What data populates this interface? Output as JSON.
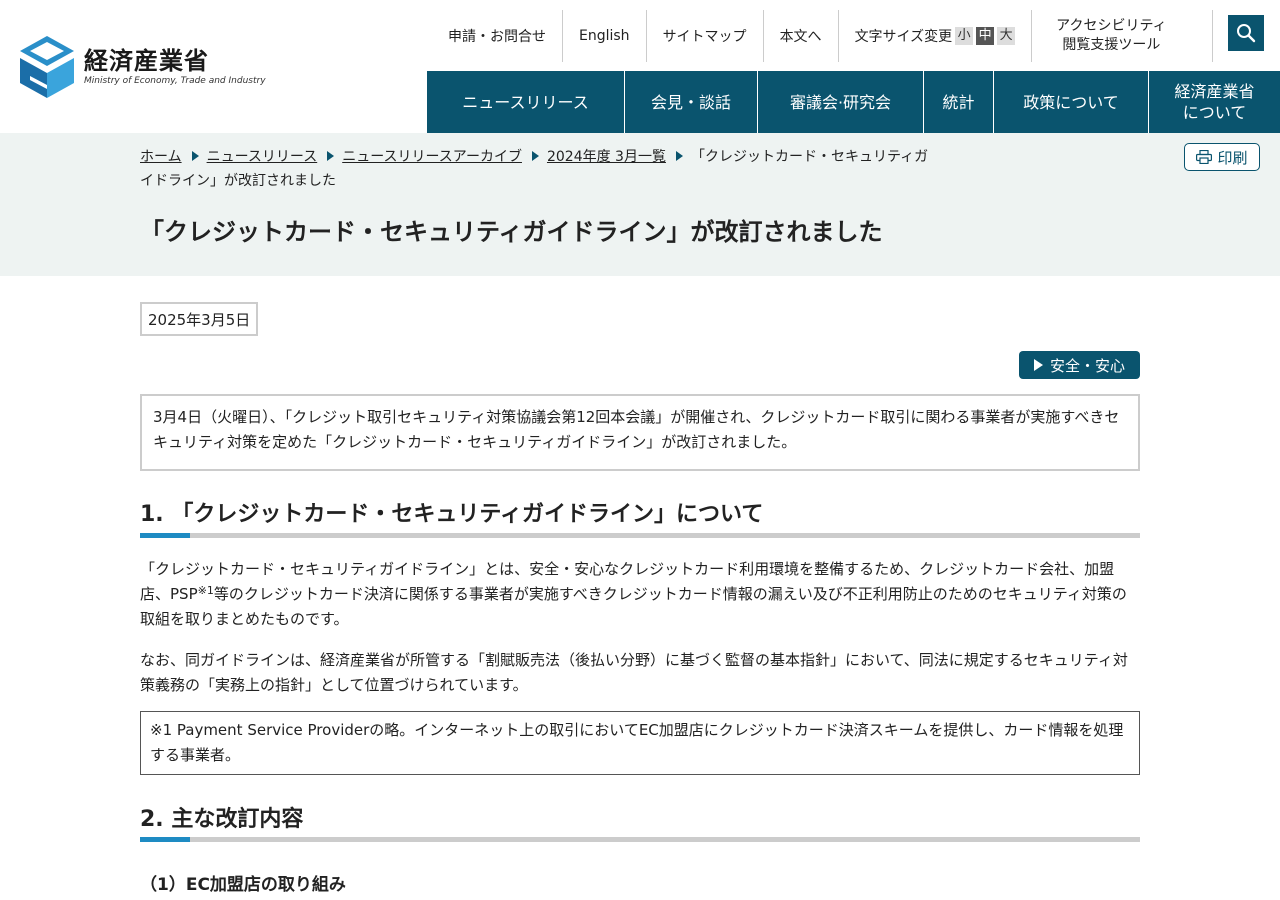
{
  "logo": {
    "ja": "経済産業省",
    "en": "Ministry of Economy, Trade and Industry"
  },
  "util_nav": {
    "contact": "申請・お問合せ",
    "english": "English",
    "sitemap": "サイトマップ",
    "to_main": "本文へ",
    "font_size_label": "文字サイズ変更",
    "size_small": "小",
    "size_medium": "中",
    "size_large": "大",
    "accessibility_line1": "アクセシビリティ",
    "accessibility_line2": "閲覧支援ツール"
  },
  "global_nav": {
    "news": "ニュースリリース",
    "press": "会見・談話",
    "council": "審議会·研究会",
    "stats": "統計",
    "policy": "政策について",
    "about_line1": "経済産業省",
    "about_line2": "について"
  },
  "breadcrumb": {
    "home": "ホーム",
    "news": "ニュースリリース",
    "archive": "ニュースリリースアーカイブ",
    "month": "2024年度 3月一覧",
    "current": "「クレジットカード・セキュリティガイドライン」が改訂されました"
  },
  "print_label": "印刷",
  "page_title": "「クレジットカード・セキュリティガイドライン」が改訂されました",
  "date": "2025年3月5日",
  "tag": "安全・安心",
  "summary": "3月4日（火曜日）、「クレジット取引セキュリティ対策協議会第12回本会議」が開催され、クレジットカード取引に関わる事業者が実施すべきセキュリティ対策を定めた「クレジットカード・セキュリティガイドライン」が改訂されました。",
  "section1": {
    "heading": "1. 「クレジットカード・セキュリティガイドライン」について",
    "para1_a": "「クレジットカード・セキュリティガイドライン」とは、安全・安心なクレジットカード利用環境を整備するため、クレジットカード会社、加盟店、PSP",
    "para1_sup": "※1",
    "para1_b": "等のクレジットカード決済に関係する事業者が実施すべきクレジットカード情報の漏えい及び不正利用防止のためのセキュリティ対策の取組を取りまとめたものです。",
    "para2": "なお、同ガイドラインは、経済産業省が所管する「割賦販売法（後払い分野）に基づく監督の基本指針」において、同法に規定するセキュリティ対策義務の「実務上の指針」として位置づけられています。",
    "note": "※1 Payment Service Providerの略。インターネット上の取引においてEC加盟店にクレジットカード決済スキームを提供し、カード情報を処理する事業者。"
  },
  "section2": {
    "heading": "2. 主な改訂内容",
    "sub1": "（1）EC加盟店の取り組み"
  }
}
